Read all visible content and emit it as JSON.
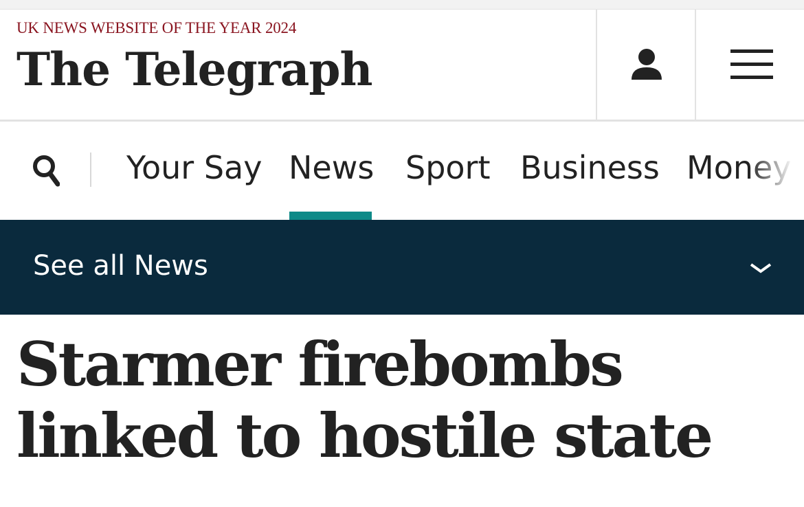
{
  "header": {
    "award": "UK NEWS WEBSITE OF THE YEAR 2024",
    "logo_text": "The Telegraph",
    "account_icon": "person-icon",
    "menu_icon": "hamburger-menu-icon"
  },
  "nav": {
    "search_icon": "search-icon",
    "items": [
      {
        "label": "Your Say",
        "active": false
      },
      {
        "label": "News",
        "active": true
      },
      {
        "label": "Sport",
        "active": false
      },
      {
        "label": "Business",
        "active": false
      },
      {
        "label": "Money",
        "active": false
      }
    ]
  },
  "subnav": {
    "label": "See all News",
    "icon": "chevron-down-icon"
  },
  "article": {
    "headline": "Starmer firebombs linked to hostile state"
  },
  "colors": {
    "award": "#8a1520",
    "active_tab": "#0e8a88",
    "subnav_bg": "#0a2a3d",
    "text": "#222222"
  }
}
